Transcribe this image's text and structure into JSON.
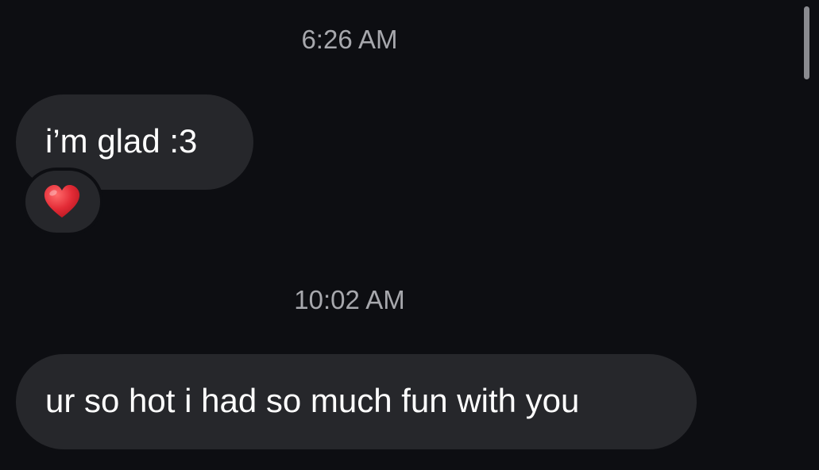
{
  "conversation": {
    "messages": [
      {
        "timestamp": "6:26 AM",
        "text": "i’m glad :3",
        "reaction": {
          "icon": "red-heart-icon",
          "color": "#e0242f"
        }
      },
      {
        "timestamp": "10:02 AM",
        "text": "ur so hot i had so much fun with you"
      }
    ]
  },
  "colors": {
    "background": "#0d0e12",
    "bubble": "#26272b",
    "timestamp": "#a7a8ad",
    "text": "#ffffff"
  }
}
